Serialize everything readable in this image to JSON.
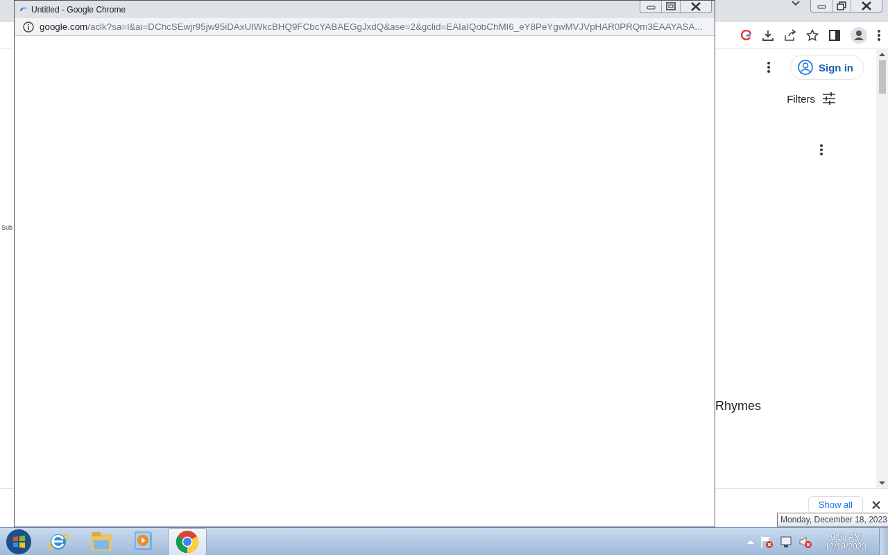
{
  "background_browser": {
    "side_text": "Sub",
    "sign_in": "Sign in",
    "filters": "Filters",
    "heading": "Rhymes",
    "download_bar": {
      "show_all": "Show all"
    }
  },
  "popup": {
    "title": "Untitled - Google Chrome",
    "url_host": "google.com",
    "url_rest": "/aclk?sa=l&ai=DChcSEwjr95jw95iDAxUIWkcBHQ9FCbcYABAEGgJxdQ&ase=2&gclid=EAIaIQobChMI6_eY8PeYgwMVJVpHAR0PRQm3EAAYASA..."
  },
  "taskbar": {
    "apps": [
      {
        "kind": "ie",
        "selected": false
      },
      {
        "kind": "explorer",
        "selected": false
      },
      {
        "kind": "media",
        "selected": false
      },
      {
        "kind": "chrome",
        "selected": true
      }
    ],
    "clock": {
      "time": "9:59 AM",
      "date": "12/18/2023"
    },
    "tooltip": "Monday, December 18, 2023"
  }
}
